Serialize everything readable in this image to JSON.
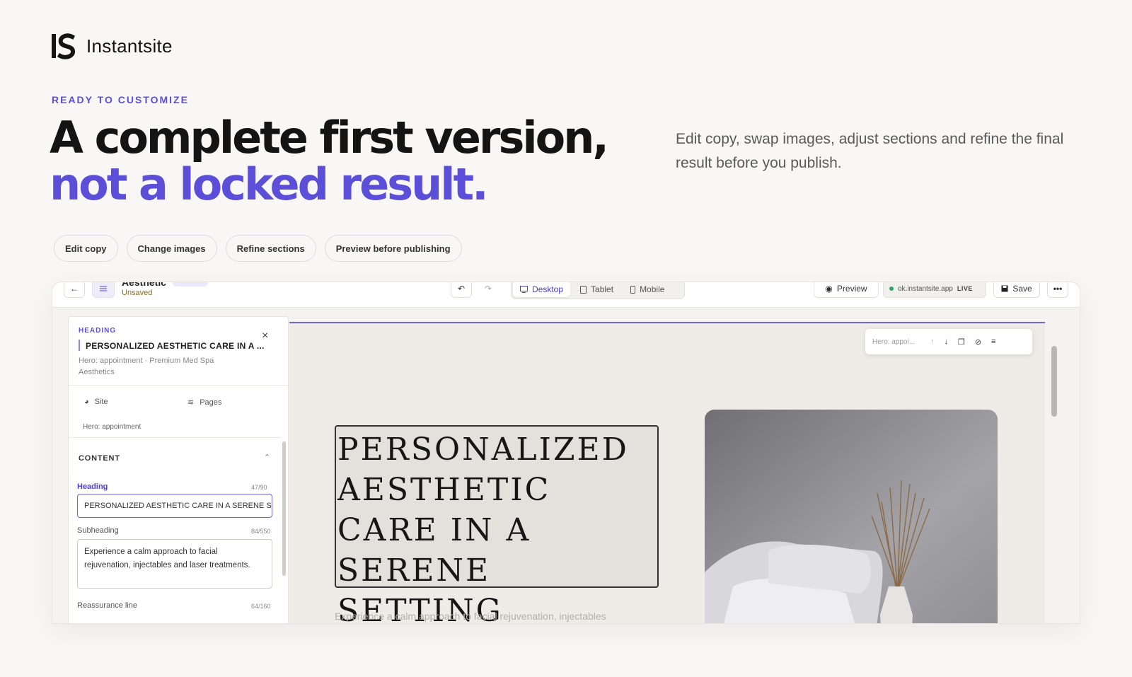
{
  "brand": {
    "name": "Instantsite"
  },
  "eyebrow": "READY TO CUSTOMIZE",
  "headline": {
    "line1": "A complete first version,",
    "line2": "not a locked result."
  },
  "lead": "Edit copy, swap images, adjust sections and refine the final result before you publish.",
  "chips": [
    "Edit copy",
    "Change images",
    "Refine sections",
    "Preview before publishing"
  ],
  "editor": {
    "topbar": {
      "site_title": "Aesthetic",
      "status": "Unsaved",
      "devices": [
        {
          "label": "Desktop",
          "icon": "monitor-icon",
          "active": true
        },
        {
          "label": "Tablet",
          "icon": "tablet-icon",
          "active": false
        },
        {
          "label": "Mobile",
          "icon": "phone-icon",
          "active": false
        }
      ],
      "preview_label": "Preview",
      "domain": "ok.instantsite.app",
      "live_label": "LIVE",
      "save_label": "Save",
      "more_label": "•••"
    },
    "panel": {
      "kicker": "HEADING",
      "title": "PERSONALIZED AESTHETIC CARE IN A ...",
      "context": "Hero: appointment · Premium Med Spa Aesthetics",
      "tabs": {
        "site": "Site",
        "pages": "Pages"
      },
      "crumb": "Hero: appointment",
      "section": "CONTENT",
      "fields": {
        "heading_label": "Heading",
        "heading_count": "47/90",
        "heading_value": "PERSONALIZED AESTHETIC CARE IN A SERENE SETTING",
        "subheading_label": "Subheading",
        "subheading_count": "84/550",
        "subheading_value": "Experience a calm approach to facial rejuvenation, injectables and laser treatments.",
        "reassurance_label": "Reassurance line",
        "reassurance_count": "64/160"
      }
    },
    "canvas": {
      "toolbar_label": "Hero: appoi...",
      "hero_heading_lines": [
        "PERSONALIZED",
        "AESTHETIC",
        "CARE IN A",
        "SERENE SETTING"
      ],
      "hero_paragraph": "Experience a calm approach to facial rejuvenation, injectables"
    }
  },
  "colors": {
    "accent": "#5b4fd9",
    "text": "#141414",
    "muted": "#5a5a5a",
    "live": "#2aa86a"
  }
}
